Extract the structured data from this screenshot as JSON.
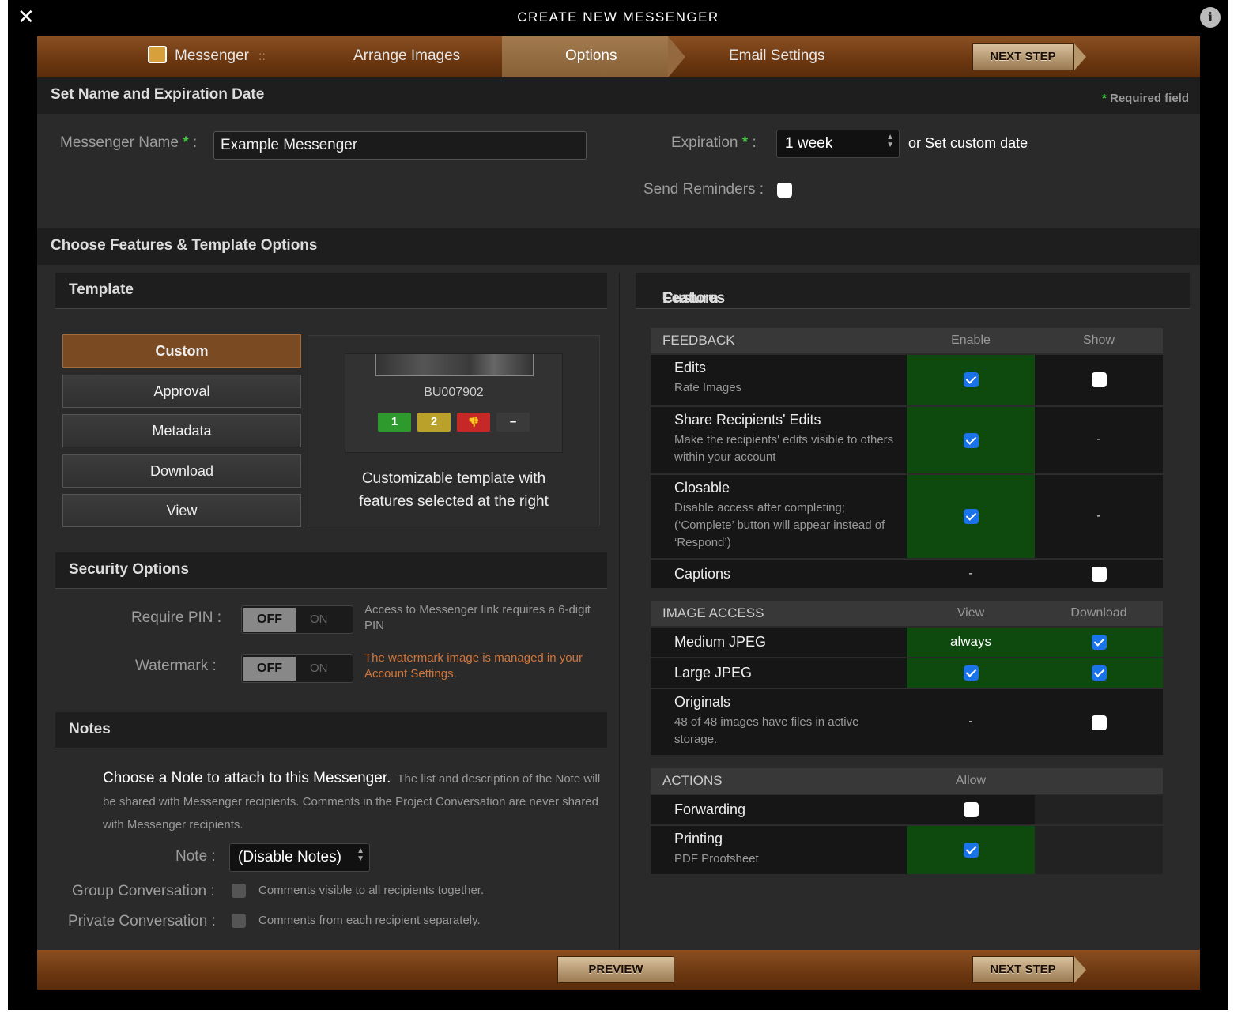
{
  "window": {
    "title": "CREATE NEW MESSENGER"
  },
  "steps": {
    "messenger": "Messenger",
    "separator": "::",
    "arrange": "Arrange Images",
    "options": "Options",
    "email": "Email Settings",
    "next": "NEXT STEP"
  },
  "name_section": {
    "title": "Set Name and Expiration Date",
    "required_star": "*",
    "required_text": "Required field",
    "name_label": "Messenger Name",
    "name_colon": ":",
    "name_value": "Example Messenger",
    "expiration_label": "Expiration",
    "expiration_value": "1 week",
    "or": "or",
    "custom_date": "Set custom date",
    "reminders_label": "Send Reminders :",
    "reminders_checked": false
  },
  "features_section": {
    "title": "Choose Features & Template Options"
  },
  "template": {
    "title": "Template",
    "buttons": [
      "Custom",
      "Approval",
      "Metadata",
      "Download",
      "View"
    ],
    "selected": "Custom",
    "preview_id": "BU007902",
    "ratings": [
      "1",
      "2",
      "👎",
      "–"
    ],
    "rating_colors": [
      "#2e9a2e",
      "#b9a12a",
      "#c62828",
      "#3a3a3a"
    ],
    "description": "Customizable template with features selected at the right"
  },
  "security": {
    "title": "Security Options",
    "pin_label": "Require PIN :",
    "pin_off": "OFF",
    "pin_on": "ON",
    "pin_hint": "Access to Messenger link requires a 6-digit PIN",
    "watermark_label": "Watermark :",
    "watermark_off": "OFF",
    "watermark_on": "ON",
    "watermark_hint": "The watermark image is managed in your Account Settings."
  },
  "notes": {
    "title": "Notes",
    "headline": "Choose a Note to attach to this Messenger.",
    "description": "The list and description of the Note will be shared with Messenger recipients. Comments in the Project Conversation are never shared with Messenger recipients.",
    "note_label": "Note :",
    "note_value": "(Disable Notes)",
    "group_label": "Group Conversation :",
    "group_hint": "Comments visible to all recipients together.",
    "private_label": "Private Conversation :",
    "private_hint": "Comments from each recipient separately."
  },
  "custom_features": {
    "title_quote_open": "“",
    "title_name": "Custom",
    "title_quote_close": "”",
    "title_rest": "Features",
    "feedback": {
      "header": "FEEDBACK",
      "col1": "Enable",
      "col2": "Show",
      "edits": "Edits",
      "edits_sub": "Rate Images",
      "share": "Share Recipients' Edits",
      "share_sub": "Make the recipients' edits visible to others within your account",
      "closable": "Closable",
      "closable_sub": "Disable access after completing; (‘Complete’ button will appear instead of ‘Respond’)",
      "captions": "Captions",
      "dash": "-"
    },
    "image_access": {
      "header": "IMAGE ACCESS",
      "col1": "View",
      "col2": "Download",
      "medium": "Medium JPEG",
      "medium_view": "always",
      "large": "Large JPEG",
      "originals": "Originals",
      "originals_sub": "48 of 48 images have files in active storage.",
      "dash": "-"
    },
    "actions": {
      "header": "ACTIONS",
      "col1": "Allow",
      "forwarding": "Forwarding",
      "printing": "Printing",
      "printing_sub": "PDF Proofsheet"
    }
  },
  "footer": {
    "preview": "PREVIEW",
    "next": "NEXT STEP"
  },
  "colors": {
    "accent": "#7a4b22",
    "enabled_cell": "#0e4a0e",
    "checkbox": "#1a73e8",
    "required_star": "#3ec43e"
  }
}
